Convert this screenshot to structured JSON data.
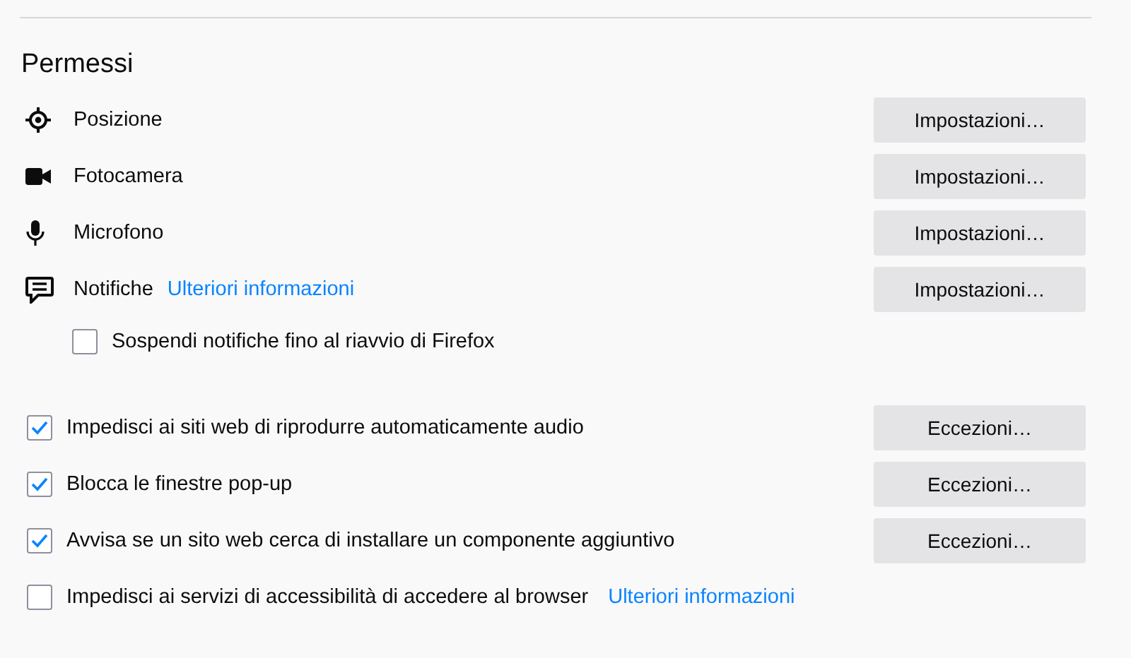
{
  "heading": "Permessi",
  "permissions": [
    {
      "kind": "location",
      "label": "Posizione",
      "button": "Impostazioni…"
    },
    {
      "kind": "camera",
      "label": "Fotocamera",
      "button": "Impostazioni…"
    },
    {
      "kind": "microphone",
      "label": "Microfono",
      "button": "Impostazioni…"
    },
    {
      "kind": "notifications",
      "label": "Notifiche",
      "link": "Ulteriori informazioni",
      "button": "Impostazioni…",
      "sub_option": {
        "label": "Sospendi notifiche fino al riavvio di Firefox",
        "checked": false
      }
    }
  ],
  "options": [
    {
      "label": "Impedisci ai siti web di riprodurre automaticamente audio",
      "checked": true,
      "button": "Eccezioni…"
    },
    {
      "label": "Blocca le finestre pop-up",
      "checked": true,
      "button": "Eccezioni…"
    },
    {
      "label": "Avvisa se un sito web cerca di installare un componente aggiuntivo",
      "checked": true,
      "button": "Eccezioni…"
    },
    {
      "label": "Impedisci ai servizi di accessibilità di accedere al browser",
      "checked": false,
      "link": "Ulteriori informazioni"
    }
  ]
}
